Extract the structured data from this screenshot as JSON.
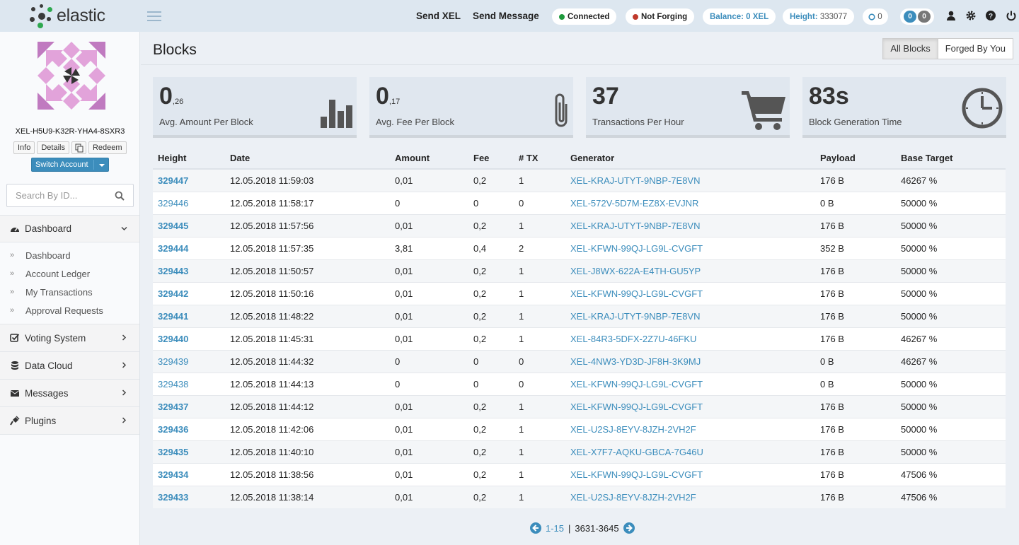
{
  "header": {
    "app_name": "elastic",
    "links": [
      "Send XEL",
      "Send Message"
    ],
    "status_connected": "Connected",
    "status_forging": "Not Forging",
    "balance_label": "Balance: 0 XEL",
    "height_label": "Height:",
    "height_value": "333077",
    "pending_count": "0",
    "badge_a": "0",
    "badge_b": "0",
    "colors": {
      "connected": "#1e9a3c",
      "not_forging": "#c0392b",
      "accent": "#3c8dbc"
    }
  },
  "sidebar": {
    "account_id": "XEL-H5U9-K32R-YHA4-8SXR3",
    "buttons": [
      "Info",
      "Details",
      "Redeem"
    ],
    "copy_icon": "copy-icon",
    "switch_label": "Switch Account",
    "search_placeholder": "Search By ID...",
    "dashboard": {
      "label": "Dashboard",
      "items": [
        "Dashboard",
        "Account Ledger",
        "My Transactions",
        "Approval Requests"
      ]
    },
    "sections": [
      {
        "label": "Voting System",
        "icon": "check-square-icon"
      },
      {
        "label": "Data Cloud",
        "icon": "database-icon"
      },
      {
        "label": "Messages",
        "icon": "envelope-icon"
      },
      {
        "label": "Plugins",
        "icon": "plug-icon"
      }
    ]
  },
  "main": {
    "title": "Blocks",
    "tabs": [
      "All Blocks",
      "Forged By You"
    ],
    "stats": [
      {
        "value": "0",
        "fraction": ",26",
        "label": "Avg. Amount Per Block",
        "icon": "bar-chart-icon"
      },
      {
        "value": "0",
        "fraction": ",17",
        "label": "Avg. Fee Per Block",
        "icon": "paperclip-icon"
      },
      {
        "value": "37",
        "fraction": "",
        "label": "Transactions Per Hour",
        "icon": "shopping-cart-icon"
      },
      {
        "value": "83s",
        "fraction": "",
        "label": "Block Generation Time",
        "icon": "clock-icon"
      }
    ],
    "table": {
      "columns": [
        "Height",
        "Date",
        "Amount",
        "Fee",
        "# TX",
        "Generator",
        "Payload",
        "Base Target"
      ],
      "rows": [
        [
          "329447",
          "12.05.2018 11:59:03",
          "0,01",
          "0,2",
          "1",
          "XEL-KRAJ-UTYT-9NBP-7E8VN",
          "176 B",
          "46267 %"
        ],
        [
          "329446",
          "12.05.2018 11:58:17",
          "0",
          "0",
          "0",
          "XEL-572V-5D7M-EZ8X-EVJNR",
          "0 B",
          "50000 %"
        ],
        [
          "329445",
          "12.05.2018 11:57:56",
          "0,01",
          "0,2",
          "1",
          "XEL-KRAJ-UTYT-9NBP-7E8VN",
          "176 B",
          "50000 %"
        ],
        [
          "329444",
          "12.05.2018 11:57:35",
          "3,81",
          "0,4",
          "2",
          "XEL-KFWN-99QJ-LG9L-CVGFT",
          "352 B",
          "50000 %"
        ],
        [
          "329443",
          "12.05.2018 11:50:57",
          "0,01",
          "0,2",
          "1",
          "XEL-J8WX-622A-E4TH-GU5YP",
          "176 B",
          "50000 %"
        ],
        [
          "329442",
          "12.05.2018 11:50:16",
          "0,01",
          "0,2",
          "1",
          "XEL-KFWN-99QJ-LG9L-CVGFT",
          "176 B",
          "50000 %"
        ],
        [
          "329441",
          "12.05.2018 11:48:22",
          "0,01",
          "0,2",
          "1",
          "XEL-KRAJ-UTYT-9NBP-7E8VN",
          "176 B",
          "50000 %"
        ],
        [
          "329440",
          "12.05.2018 11:45:31",
          "0,01",
          "0,2",
          "1",
          "XEL-84R3-5DFX-2Z7U-46FKU",
          "176 B",
          "46267 %"
        ],
        [
          "329439",
          "12.05.2018 11:44:32",
          "0",
          "0",
          "0",
          "XEL-4NW3-YD3D-JF8H-3K9MJ",
          "0 B",
          "46267 %"
        ],
        [
          "329438",
          "12.05.2018 11:44:13",
          "0",
          "0",
          "0",
          "XEL-KFWN-99QJ-LG9L-CVGFT",
          "0 B",
          "50000 %"
        ],
        [
          "329437",
          "12.05.2018 11:44:12",
          "0,01",
          "0,2",
          "1",
          "XEL-KFWN-99QJ-LG9L-CVGFT",
          "176 B",
          "50000 %"
        ],
        [
          "329436",
          "12.05.2018 11:42:06",
          "0,01",
          "0,2",
          "1",
          "XEL-U2SJ-8EYV-8JZH-2VH2F",
          "176 B",
          "50000 %"
        ],
        [
          "329435",
          "12.05.2018 11:40:10",
          "0,01",
          "0,2",
          "1",
          "XEL-X7F7-AQKU-GBCA-7G46U",
          "176 B",
          "50000 %"
        ],
        [
          "329434",
          "12.05.2018 11:38:56",
          "0,01",
          "0,2",
          "1",
          "XEL-KFWN-99QJ-LG9L-CVGFT",
          "176 B",
          "47506 %"
        ],
        [
          "329433",
          "12.05.2018 11:38:14",
          "0,01",
          "0,2",
          "1",
          "XEL-U2SJ-8EYV-8JZH-2VH2F",
          "176 B",
          "47506 %"
        ]
      ]
    },
    "pager": {
      "range": "1-15",
      "separator": "|",
      "total": "3631-3645"
    }
  }
}
